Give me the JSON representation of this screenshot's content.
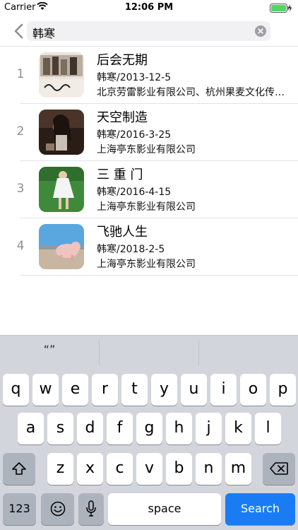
{
  "status_bar": {
    "carrier": "Carrier",
    "time": "12:06 PM"
  },
  "search": {
    "query": "韩寒"
  },
  "results": [
    {
      "index": "1",
      "title": "后会无期",
      "meta": "韩寒/2013-12-5",
      "company": "北京劳雷影业有限公司、杭州果麦文化传媒股份有限公司"
    },
    {
      "index": "2",
      "title": "天空制造",
      "meta": "韩寒/2016-3-25",
      "company": "上海亭东影业有限公司"
    },
    {
      "index": "3",
      "title": "三 重 门",
      "meta": "韩寒/2016-4-15",
      "company": "上海亭东影业有限公司"
    },
    {
      "index": "4",
      "title": "飞驰人生",
      "meta": "韩寒/2018-2-5",
      "company": "上海亭东影业有限公司"
    }
  ],
  "keyboard": {
    "suggestions": [
      "“”",
      "",
      ""
    ],
    "row1": [
      "q",
      "w",
      "e",
      "r",
      "t",
      "y",
      "u",
      "i",
      "o",
      "p"
    ],
    "row2": [
      "a",
      "s",
      "d",
      "f",
      "g",
      "h",
      "j",
      "k",
      "l"
    ],
    "row3": [
      "z",
      "x",
      "c",
      "v",
      "b",
      "n",
      "m"
    ],
    "numbers_label": "123",
    "space_label": "space",
    "search_label": "Search"
  },
  "colors": {
    "accent": "#1a7cf5",
    "keyboard_bg": "#d2d5db",
    "battery": "#4cd964"
  }
}
